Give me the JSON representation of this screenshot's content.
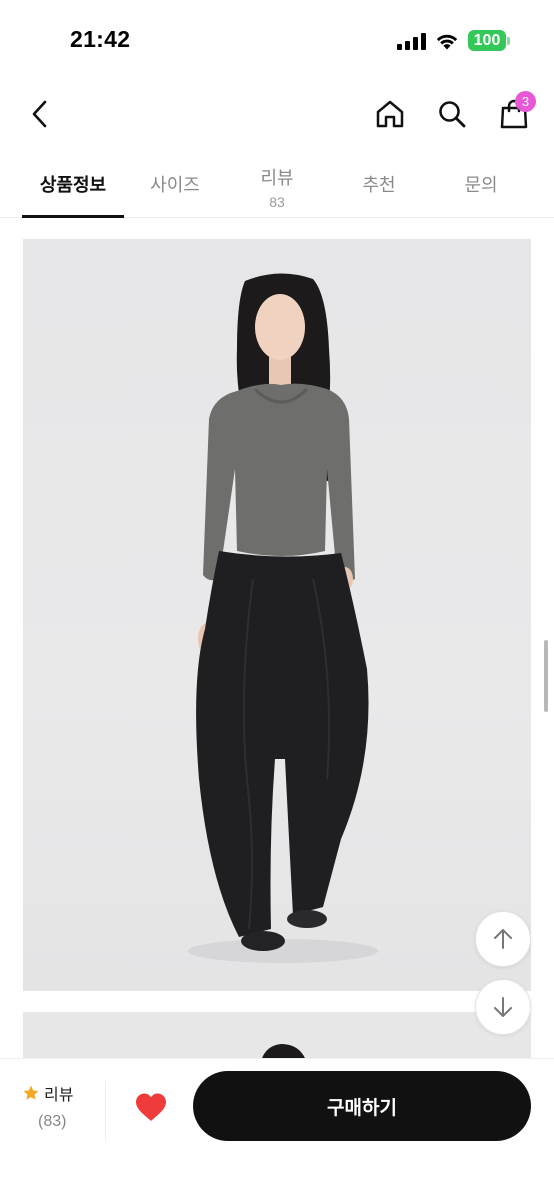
{
  "status_bar": {
    "time": "21:42",
    "battery": "100",
    "signal_icon": "cellular-signal-icon",
    "wifi_icon": "wifi-icon"
  },
  "nav": {
    "back_icon": "back-chevron-icon",
    "home_icon": "home-icon",
    "search_icon": "search-icon",
    "cart_icon": "shopping-bag-icon",
    "cart_count": "3"
  },
  "tabs": [
    {
      "label": "상품정보",
      "count": "",
      "active": true
    },
    {
      "label": "사이즈",
      "count": "",
      "active": false
    },
    {
      "label": "리뷰",
      "count": "83",
      "active": false
    },
    {
      "label": "추천",
      "count": "",
      "active": false
    },
    {
      "label": "문의",
      "count": "",
      "active": false
    }
  ],
  "product": {
    "image_subject": "model-wearing-gray-top-and-black-wide-jeans"
  },
  "floating": {
    "up_icon": "arrow-up-icon",
    "down_icon": "arrow-down-icon"
  },
  "bottom_bar": {
    "review_label": "리뷰",
    "review_count": "(83)",
    "star_icon": "star-icon",
    "like_icon": "heart-icon",
    "buy_label": "구매하기"
  },
  "colors": {
    "accent_dark": "#111111",
    "badge": "#e857d6",
    "battery": "#34c759",
    "heart": "#ef3b3b",
    "star": "#f5a623"
  }
}
